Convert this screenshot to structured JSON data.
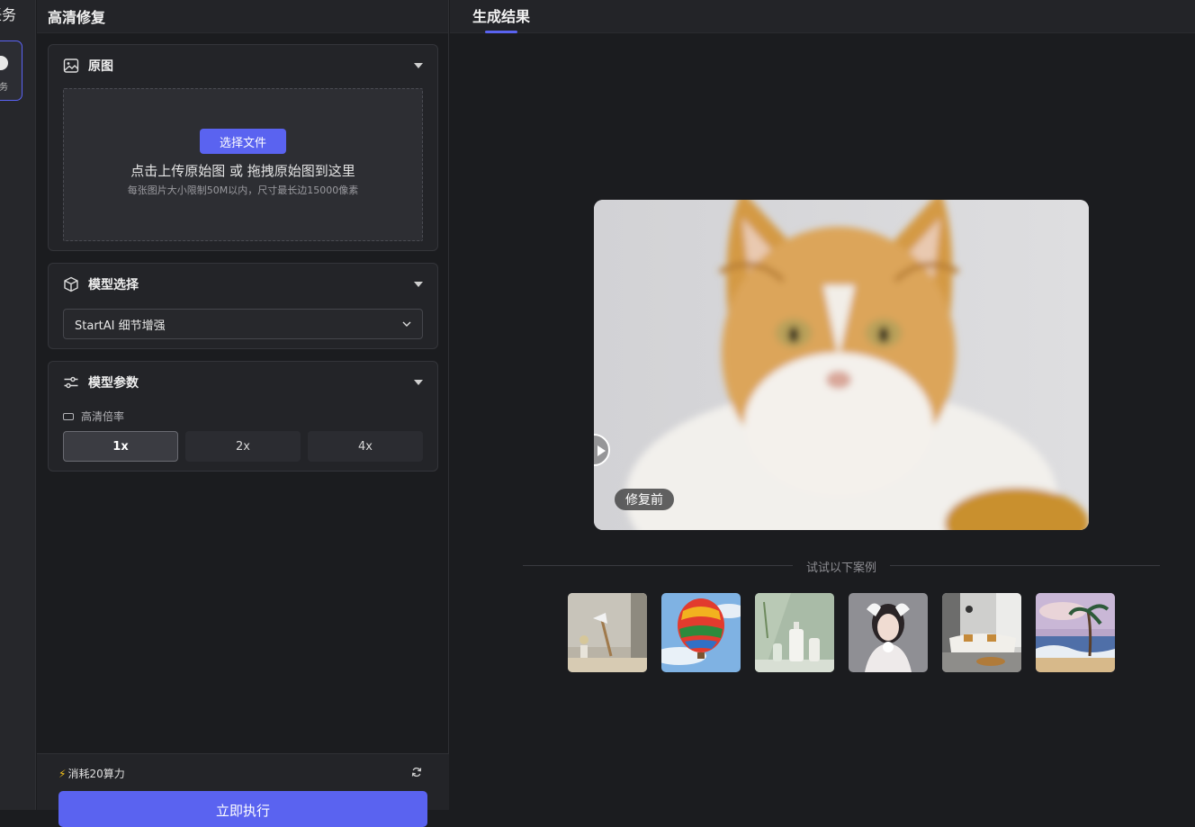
{
  "rail": {
    "title": "任务",
    "card_label": "务"
  },
  "panel": {
    "title": "高清修复"
  },
  "original": {
    "title": "原图",
    "choose_button": "选择文件",
    "upload_text": "点击上传原始图 或 拖拽原始图到这里",
    "upload_hint": "每张图片大小限制50M以内，尺寸最长边15000像素"
  },
  "model": {
    "title": "模型选择",
    "selected": "StartAI 细节增强"
  },
  "params": {
    "title": "模型参数",
    "scale_label": "高清倍率",
    "scale_options": [
      "1x",
      "2x",
      "4x"
    ],
    "selected_scale": "1x"
  },
  "footer": {
    "cost": "消耗20算力",
    "run_button": "立即执行"
  },
  "main": {
    "title": "生成结果",
    "preview_badge": "修复前",
    "samples_title": "试试以下案例",
    "samples": [
      "lamp-scene",
      "hot-air-balloon",
      "product-bottles",
      "portrait-woman",
      "sofa-interior",
      "beach-painting"
    ]
  },
  "colors": {
    "accent": "#5a63f0",
    "background": "#1b1c1f",
    "panel": "#232428",
    "bolt": "#f4c21b"
  }
}
